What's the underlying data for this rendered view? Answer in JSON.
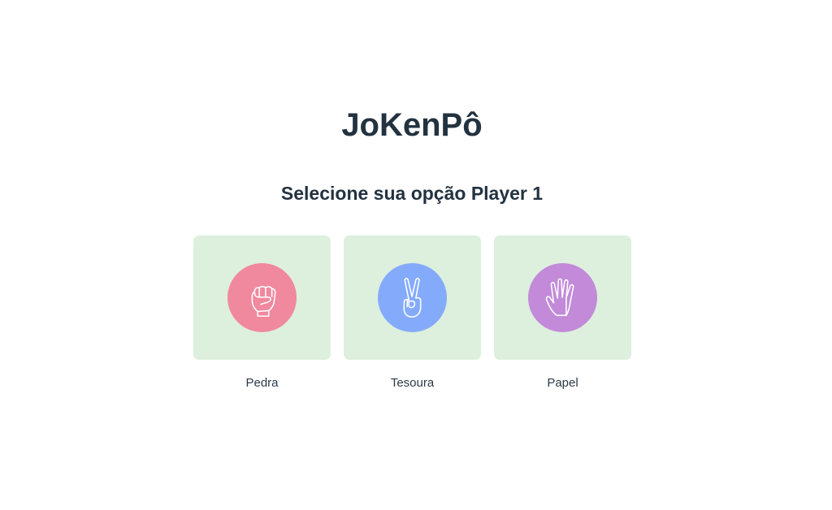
{
  "app": {
    "title": "JoKenPô",
    "subtitle": "Selecione sua opção Player 1"
  },
  "options": [
    {
      "label": "Pedra",
      "icon": "fist-icon",
      "color": "#f0889e"
    },
    {
      "label": "Tesoura",
      "icon": "peace-hand-icon",
      "color": "#84abfb"
    },
    {
      "label": "Papel",
      "icon": "open-hand-icon",
      "color": "#c28ad9"
    }
  ],
  "colors": {
    "card_background": "#ddefdd",
    "text": "#233240"
  }
}
